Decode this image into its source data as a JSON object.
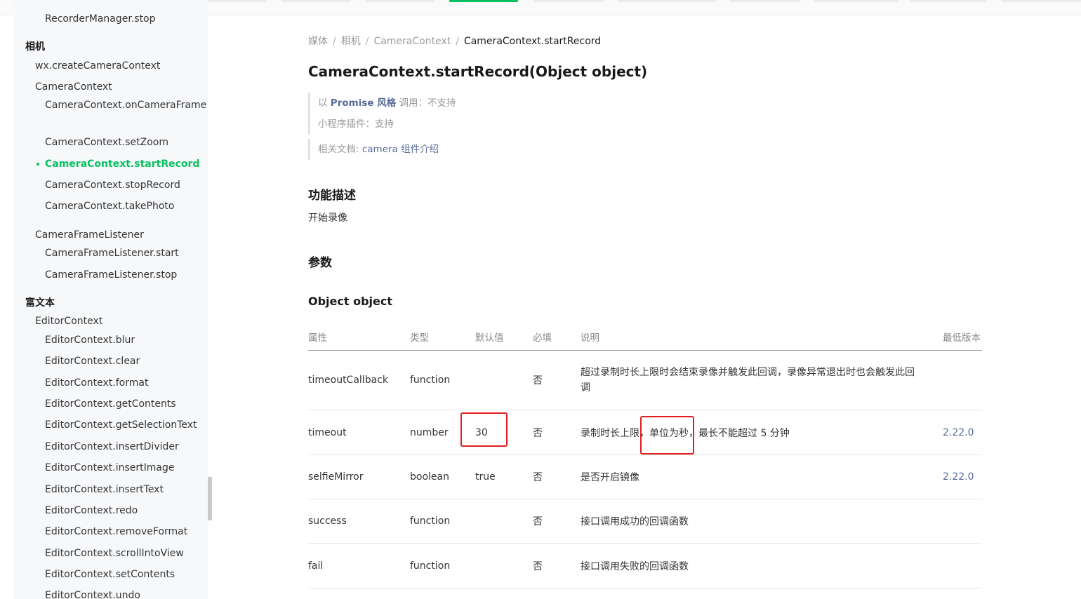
{
  "sidebar": {
    "prev_item": "RecorderManager.stop",
    "section_camera": "相机",
    "create_camera_context": "wx.createCameraContext",
    "camera_context": "CameraContext",
    "on_camera_frame": "CameraContext.onCameraFrame",
    "set_zoom": "CameraContext.setZoom",
    "start_record": "CameraContext.startRecord",
    "stop_record": "CameraContext.stopRecord",
    "take_photo": "CameraContext.takePhoto",
    "camera_frame_listener": "CameraFrameListener",
    "cfl_start": "CameraFrameListener.start",
    "cfl_stop": "CameraFrameListener.stop",
    "section_rich_text": "富文本",
    "editor_context": "EditorContext",
    "editor_items": [
      "EditorContext.blur",
      "EditorContext.clear",
      "EditorContext.format",
      "EditorContext.getContents",
      "EditorContext.getSelectionText",
      "EditorContext.insertDivider",
      "EditorContext.insertImage",
      "EditorContext.insertText",
      "EditorContext.redo",
      "EditorContext.removeFormat",
      "EditorContext.scrollIntoView",
      "EditorContext.setContents",
      "EditorContext.undo"
    ]
  },
  "breadcrumb": [
    "媒体",
    "相机",
    "CameraContext",
    "CameraContext.startRecord"
  ],
  "breadcrumb_sep": "/",
  "page_title": "CameraContext.startRecord(Object object)",
  "notes": {
    "promise_prefix": "以 ",
    "promise_link": "Promise 风格",
    "promise_suffix": " 调用：不支持",
    "plugin": "小程序插件：支持",
    "docs_prefix": "相关文档: ",
    "docs_link": "camera 组件介绍"
  },
  "sections": {
    "description_heading": "功能描述",
    "description_text": "开始录像",
    "params_heading": "参数",
    "object_heading": "Object object"
  },
  "table": {
    "headers": [
      "属性",
      "类型",
      "默认值",
      "必填",
      "说明",
      "最低版本"
    ],
    "rows": [
      {
        "name": "timeoutCallback",
        "type": "function",
        "default": "",
        "required": "否",
        "desc": "超过录制时长上限时会结束录像并触发此回调，录像异常退出时也会触发此回调",
        "version": ""
      },
      {
        "name": "timeout",
        "type": "number",
        "default": "30",
        "required": "否",
        "desc": "录制时长上限，单位为秒，最长不能超过 5 分钟",
        "version": "2.22.0"
      },
      {
        "name": "selfieMirror",
        "type": "boolean",
        "default": "true",
        "required": "否",
        "desc": "是否开启镜像",
        "version": "2.22.0"
      },
      {
        "name": "success",
        "type": "function",
        "default": "",
        "required": "否",
        "desc": "接口调用成功的回调函数",
        "version": ""
      },
      {
        "name": "fail",
        "type": "function",
        "default": "",
        "required": "否",
        "desc": "接口调用失败的回调函数",
        "version": ""
      }
    ]
  },
  "colors": {
    "accent": "#07c160",
    "link": "#576b95",
    "highlight_box": "#e02020"
  }
}
